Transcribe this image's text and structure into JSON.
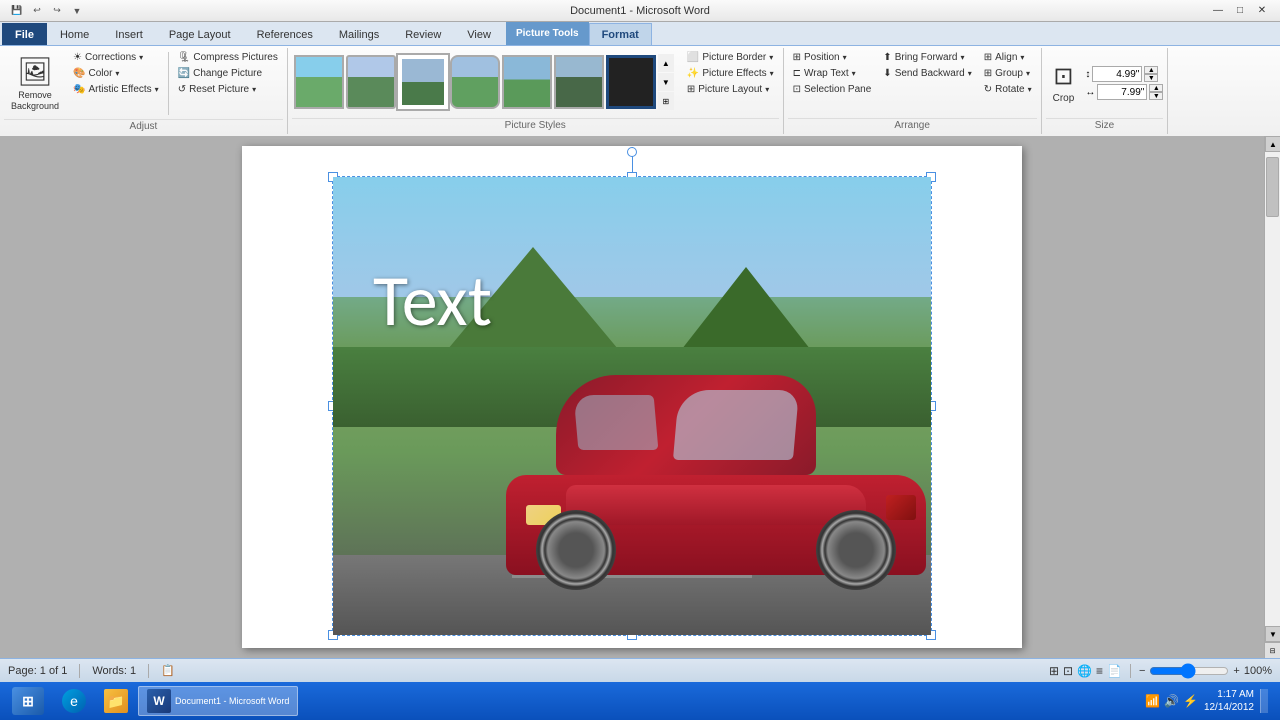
{
  "titlebar": {
    "title": "Document1 - Microsoft Word",
    "picture_tools": "Picture Tools",
    "quickaccess": [
      "save",
      "undo",
      "redo"
    ],
    "min": "—",
    "max": "□",
    "close": "✕"
  },
  "tabs": [
    {
      "label": "File",
      "id": "file"
    },
    {
      "label": "Home",
      "id": "home"
    },
    {
      "label": "Insert",
      "id": "insert"
    },
    {
      "label": "Page Layout",
      "id": "page-layout"
    },
    {
      "label": "References",
      "id": "references"
    },
    {
      "label": "Mailings",
      "id": "mailings"
    },
    {
      "label": "Review",
      "id": "review"
    },
    {
      "label": "View",
      "id": "view"
    },
    {
      "label": "Format",
      "id": "format",
      "active": true
    }
  ],
  "ribbon": {
    "adjust": {
      "label": "Adjust",
      "remove_bg": "Remove\nBackground",
      "corrections": "Corrections",
      "color": "Color",
      "artistic": "Artistic Effects",
      "compress": "Compress Pictures",
      "change": "Change Picture",
      "reset": "Reset Picture"
    },
    "picture_styles": {
      "label": "Picture Styles",
      "picture_border": "Picture Border",
      "picture_effects": "Picture Effects",
      "picture_layout": "Picture Layout"
    },
    "arrange": {
      "label": "Arrange",
      "bring_forward": "Bring Forward",
      "send_backward": "Send Backward",
      "selection_pane": "Selection Pane",
      "align": "Align",
      "group": "Group",
      "rotate": "Rotate",
      "position": "Position",
      "wrap_text": "Wrap Text"
    },
    "size": {
      "label": "Size",
      "crop": "Crop",
      "height": "4.99\"",
      "width": "7.99\""
    }
  },
  "image": {
    "overlay_text": "Text"
  },
  "statusbar": {
    "page": "Page: 1 of 1",
    "words": "Words: 1",
    "zoom": "100%"
  },
  "taskbar": {
    "time": "1:17 AM",
    "date": "12/14/2012"
  }
}
